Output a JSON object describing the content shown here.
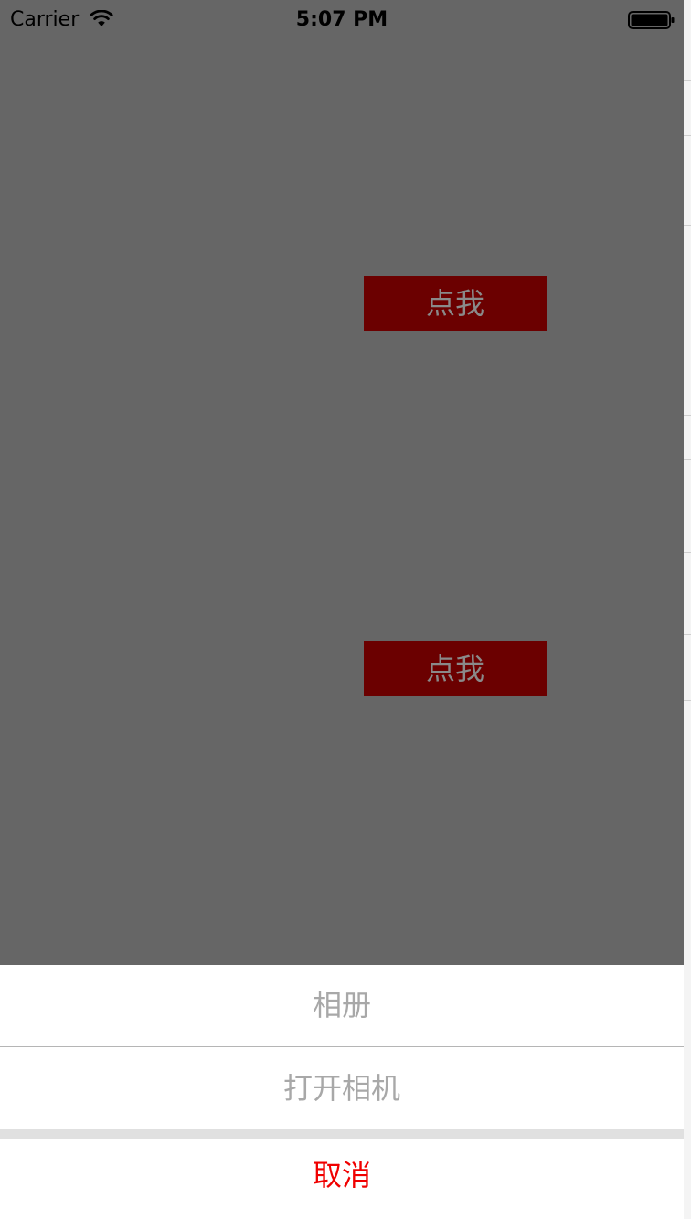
{
  "status_bar": {
    "carrier": "Carrier",
    "time": "5:07 PM",
    "icons": [
      "wifi-icon",
      "battery-icon"
    ]
  },
  "content": {
    "buttons": [
      {
        "label": "点我"
      },
      {
        "label": "点我"
      }
    ],
    "button_color": "#6b0000",
    "overlay_color": "#666666"
  },
  "action_sheet": {
    "items": [
      {
        "label": "相册"
      },
      {
        "label": "打开相机"
      }
    ],
    "cancel_label": "取消",
    "cancel_color": "#f00000"
  }
}
